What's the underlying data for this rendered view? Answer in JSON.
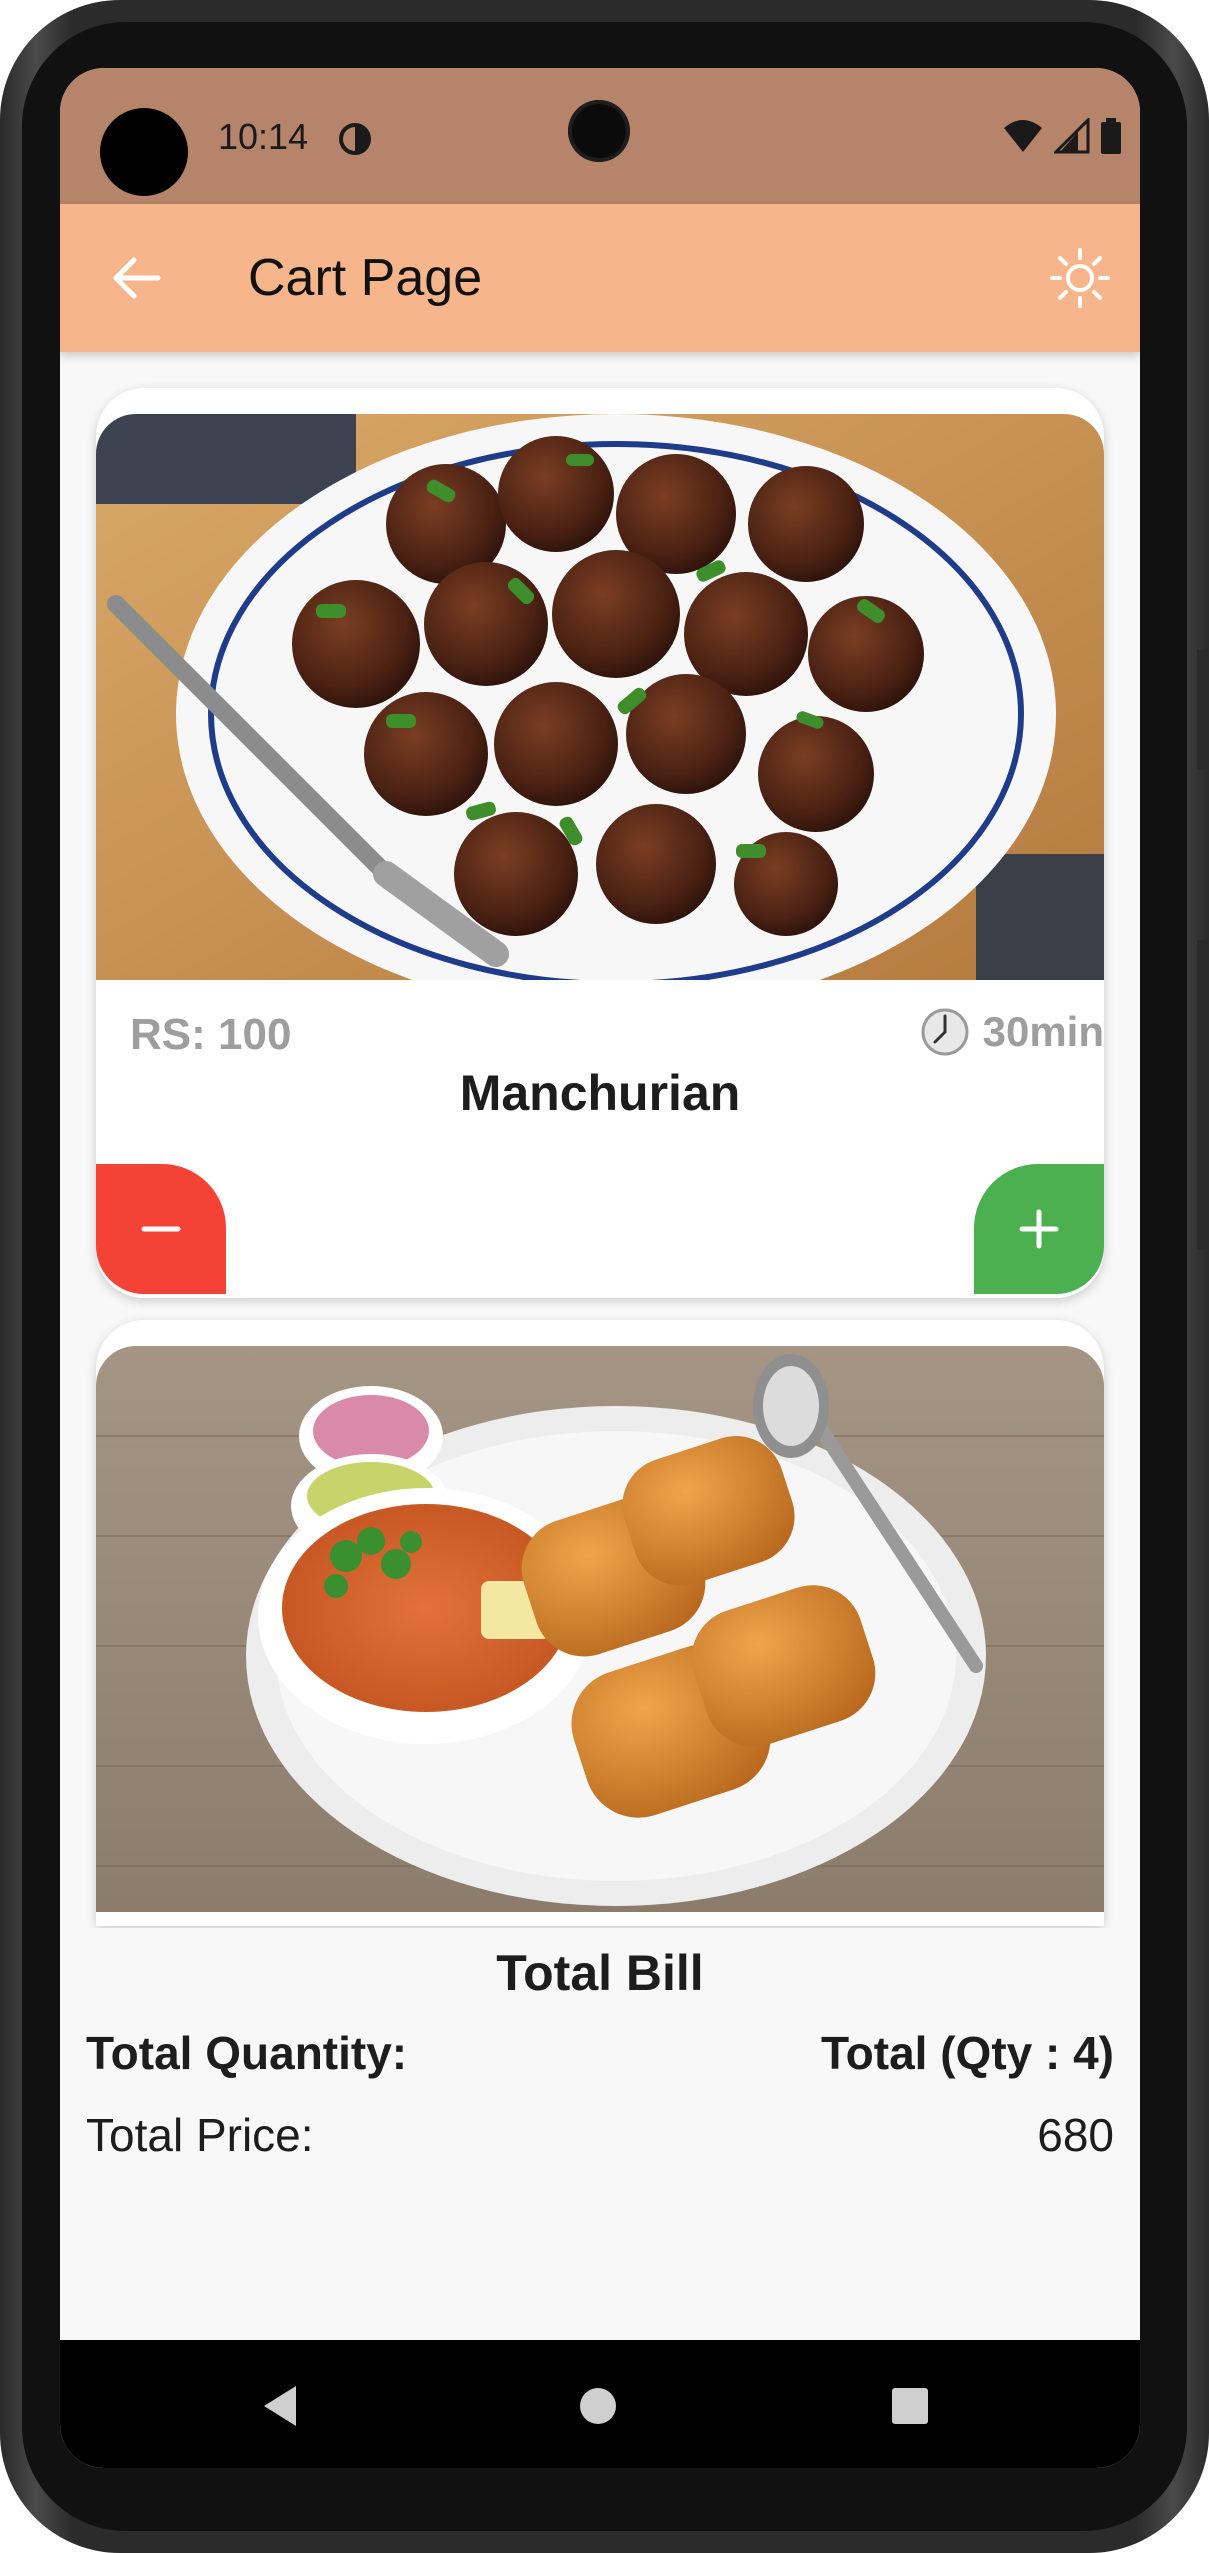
{
  "status_bar": {
    "time": "10:14"
  },
  "app_bar": {
    "title": "Cart Page",
    "back_icon": "arrow-left-icon",
    "theme_icon": "sun-icon",
    "color": "#f6b58b"
  },
  "cart_items": [
    {
      "name": "Manchurian",
      "price_label": "RS: 100",
      "time_label": "30min",
      "image": "manchurian-photo"
    },
    {
      "name": "",
      "image": "pav-bhaji-photo"
    }
  ],
  "buttons": {
    "decrease_icon": "minus-icon",
    "increase_icon": "plus-icon",
    "decrease_color": "#f44336",
    "increase_color": "#4caf50"
  },
  "summary": {
    "title": "Total Bill",
    "quantity_label": "Total Quantity:",
    "quantity_value": "Total (Qty : 4)",
    "price_label": "Total Price:",
    "price_value": "680"
  },
  "nav": {
    "back_icon": "triangle-back-icon",
    "home_icon": "circle-home-icon",
    "recents_icon": "square-recents-icon"
  }
}
